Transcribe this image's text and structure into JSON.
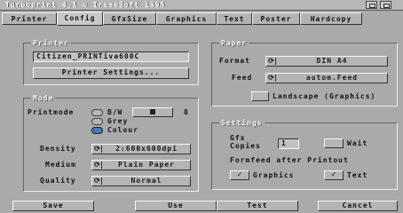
{
  "window": {
    "title": "Turboprint 4.1   © IrseeSoft 1995"
  },
  "tabs": [
    {
      "label": "Printer"
    },
    {
      "label": "Config"
    },
    {
      "label": "GfxSize"
    },
    {
      "label": "Graphics"
    },
    {
      "label": "Text"
    },
    {
      "label": "Poster"
    },
    {
      "label": "Hardcopy"
    }
  ],
  "printer": {
    "title": "Printer",
    "name": "Citizen_PRINTiva600C",
    "settings_button": "Printer Settings..."
  },
  "paper": {
    "title": "Paper",
    "format_label": "Format",
    "format_value": "DIN A4",
    "feed_label": "Feed",
    "feed_value": "autom.Feed",
    "landscape_label": "Landscape (Graphics)"
  },
  "mode": {
    "title": "Mode",
    "printmode_label": "Printmode",
    "bw_label": "B/W",
    "bw_value": "8",
    "grey_label": "Grey",
    "colour_label": "Colour",
    "density_label": "Density",
    "density_value": "2:600x600dpi",
    "medium_label": "Medium",
    "medium_value": "Plain Paper",
    "quality_label": "Quality",
    "quality_value": "Normal"
  },
  "settings": {
    "title": "Settings",
    "gfx_label_1": "Gfx",
    "gfx_label_2": "Copies",
    "copies_value": "1",
    "wait_label": "Wait",
    "formfeed_label": "Formfeed after Printout",
    "graphics_label": "Graphics",
    "text_label": "Text",
    "check_mark": "✓"
  },
  "bottom": {
    "save": "Save",
    "use": "Use",
    "test": "Test",
    "cancel": "Cancel"
  },
  "cycle_glyph": "⟳"
}
